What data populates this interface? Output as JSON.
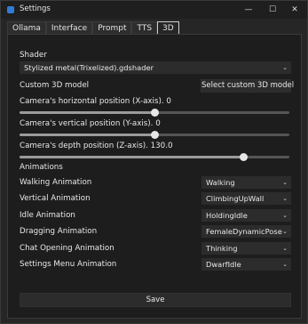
{
  "window": {
    "title": "Settings",
    "controls": {
      "minimize": "—",
      "maximize": "☐",
      "close": "✕"
    }
  },
  "tabs": [
    {
      "label": "Ollama",
      "active": false
    },
    {
      "label": "Interface",
      "active": false
    },
    {
      "label": "Prompt",
      "active": false
    },
    {
      "label": "TTS",
      "active": false
    },
    {
      "label": "3D",
      "active": true
    }
  ],
  "shader": {
    "heading": "Shader",
    "selected": "Stylized metal(Trixelized).gdshader"
  },
  "custom_model": {
    "label": "Custom 3D model",
    "button": "Select custom 3D model"
  },
  "camera": {
    "x": {
      "label": "Camera's horizontal position (X-axis). 0",
      "value": 0,
      "min": -1,
      "max": 1
    },
    "y": {
      "label": "Camera's vertical position (Y-axis). 0",
      "value": 0,
      "min": -1,
      "max": 1
    },
    "z": {
      "label": "Camera's depth position (Z-axis). 130.0",
      "value": 130.0,
      "fill_fraction": 0.83
    }
  },
  "animations": {
    "heading": "Animations",
    "rows": [
      {
        "label": "Walking Animation",
        "value": "Walking"
      },
      {
        "label": "Vertical Animation",
        "value": "ClimbingUpWall"
      },
      {
        "label": "Idle Animation",
        "value": "HoldingIdle"
      },
      {
        "label": "Dragging Animation",
        "value": "FemaleDynamicPose"
      },
      {
        "label": "Chat Opening Animation",
        "value": "Thinking"
      },
      {
        "label": "Settings Menu Animation",
        "value": "DwarfIdle"
      }
    ]
  },
  "save_button": "Save",
  "icons": {
    "app": "app-icon",
    "dropdown": "chevron-down-icon"
  },
  "colors": {
    "background": "#262626",
    "panel": "#1d1d1d",
    "control": "#2c2c2c",
    "slider_thumb": "#e6e6e6"
  }
}
